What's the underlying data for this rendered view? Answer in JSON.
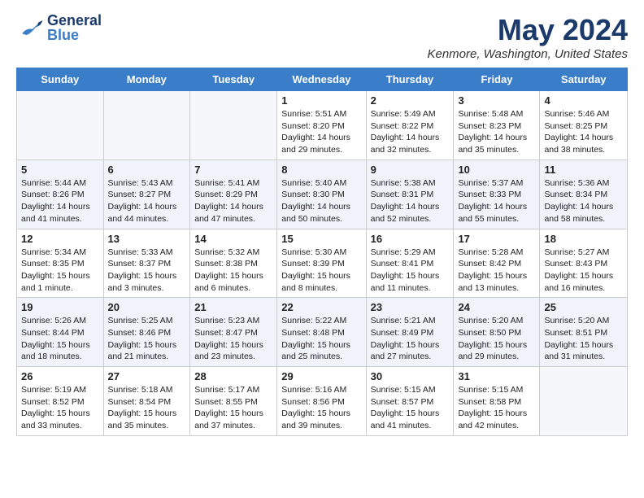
{
  "header": {
    "logo_general": "General",
    "logo_blue": "Blue",
    "month_title": "May 2024",
    "location": "Kenmore, Washington, United States"
  },
  "days_of_week": [
    "Sunday",
    "Monday",
    "Tuesday",
    "Wednesday",
    "Thursday",
    "Friday",
    "Saturday"
  ],
  "weeks": [
    [
      {
        "day": "",
        "sunrise": "",
        "sunset": "",
        "daylight": ""
      },
      {
        "day": "",
        "sunrise": "",
        "sunset": "",
        "daylight": ""
      },
      {
        "day": "",
        "sunrise": "",
        "sunset": "",
        "daylight": ""
      },
      {
        "day": "1",
        "sunrise": "Sunrise: 5:51 AM",
        "sunset": "Sunset: 8:20 PM",
        "daylight": "Daylight: 14 hours and 29 minutes."
      },
      {
        "day": "2",
        "sunrise": "Sunrise: 5:49 AM",
        "sunset": "Sunset: 8:22 PM",
        "daylight": "Daylight: 14 hours and 32 minutes."
      },
      {
        "day": "3",
        "sunrise": "Sunrise: 5:48 AM",
        "sunset": "Sunset: 8:23 PM",
        "daylight": "Daylight: 14 hours and 35 minutes."
      },
      {
        "day": "4",
        "sunrise": "Sunrise: 5:46 AM",
        "sunset": "Sunset: 8:25 PM",
        "daylight": "Daylight: 14 hours and 38 minutes."
      }
    ],
    [
      {
        "day": "5",
        "sunrise": "Sunrise: 5:44 AM",
        "sunset": "Sunset: 8:26 PM",
        "daylight": "Daylight: 14 hours and 41 minutes."
      },
      {
        "day": "6",
        "sunrise": "Sunrise: 5:43 AM",
        "sunset": "Sunset: 8:27 PM",
        "daylight": "Daylight: 14 hours and 44 minutes."
      },
      {
        "day": "7",
        "sunrise": "Sunrise: 5:41 AM",
        "sunset": "Sunset: 8:29 PM",
        "daylight": "Daylight: 14 hours and 47 minutes."
      },
      {
        "day": "8",
        "sunrise": "Sunrise: 5:40 AM",
        "sunset": "Sunset: 8:30 PM",
        "daylight": "Daylight: 14 hours and 50 minutes."
      },
      {
        "day": "9",
        "sunrise": "Sunrise: 5:38 AM",
        "sunset": "Sunset: 8:31 PM",
        "daylight": "Daylight: 14 hours and 52 minutes."
      },
      {
        "day": "10",
        "sunrise": "Sunrise: 5:37 AM",
        "sunset": "Sunset: 8:33 PM",
        "daylight": "Daylight: 14 hours and 55 minutes."
      },
      {
        "day": "11",
        "sunrise": "Sunrise: 5:36 AM",
        "sunset": "Sunset: 8:34 PM",
        "daylight": "Daylight: 14 hours and 58 minutes."
      }
    ],
    [
      {
        "day": "12",
        "sunrise": "Sunrise: 5:34 AM",
        "sunset": "Sunset: 8:35 PM",
        "daylight": "Daylight: 15 hours and 1 minute."
      },
      {
        "day": "13",
        "sunrise": "Sunrise: 5:33 AM",
        "sunset": "Sunset: 8:37 PM",
        "daylight": "Daylight: 15 hours and 3 minutes."
      },
      {
        "day": "14",
        "sunrise": "Sunrise: 5:32 AM",
        "sunset": "Sunset: 8:38 PM",
        "daylight": "Daylight: 15 hours and 6 minutes."
      },
      {
        "day": "15",
        "sunrise": "Sunrise: 5:30 AM",
        "sunset": "Sunset: 8:39 PM",
        "daylight": "Daylight: 15 hours and 8 minutes."
      },
      {
        "day": "16",
        "sunrise": "Sunrise: 5:29 AM",
        "sunset": "Sunset: 8:41 PM",
        "daylight": "Daylight: 15 hours and 11 minutes."
      },
      {
        "day": "17",
        "sunrise": "Sunrise: 5:28 AM",
        "sunset": "Sunset: 8:42 PM",
        "daylight": "Daylight: 15 hours and 13 minutes."
      },
      {
        "day": "18",
        "sunrise": "Sunrise: 5:27 AM",
        "sunset": "Sunset: 8:43 PM",
        "daylight": "Daylight: 15 hours and 16 minutes."
      }
    ],
    [
      {
        "day": "19",
        "sunrise": "Sunrise: 5:26 AM",
        "sunset": "Sunset: 8:44 PM",
        "daylight": "Daylight: 15 hours and 18 minutes."
      },
      {
        "day": "20",
        "sunrise": "Sunrise: 5:25 AM",
        "sunset": "Sunset: 8:46 PM",
        "daylight": "Daylight: 15 hours and 21 minutes."
      },
      {
        "day": "21",
        "sunrise": "Sunrise: 5:23 AM",
        "sunset": "Sunset: 8:47 PM",
        "daylight": "Daylight: 15 hours and 23 minutes."
      },
      {
        "day": "22",
        "sunrise": "Sunrise: 5:22 AM",
        "sunset": "Sunset: 8:48 PM",
        "daylight": "Daylight: 15 hours and 25 minutes."
      },
      {
        "day": "23",
        "sunrise": "Sunrise: 5:21 AM",
        "sunset": "Sunset: 8:49 PM",
        "daylight": "Daylight: 15 hours and 27 minutes."
      },
      {
        "day": "24",
        "sunrise": "Sunrise: 5:20 AM",
        "sunset": "Sunset: 8:50 PM",
        "daylight": "Daylight: 15 hours and 29 minutes."
      },
      {
        "day": "25",
        "sunrise": "Sunrise: 5:20 AM",
        "sunset": "Sunset: 8:51 PM",
        "daylight": "Daylight: 15 hours and 31 minutes."
      }
    ],
    [
      {
        "day": "26",
        "sunrise": "Sunrise: 5:19 AM",
        "sunset": "Sunset: 8:52 PM",
        "daylight": "Daylight: 15 hours and 33 minutes."
      },
      {
        "day": "27",
        "sunrise": "Sunrise: 5:18 AM",
        "sunset": "Sunset: 8:54 PM",
        "daylight": "Daylight: 15 hours and 35 minutes."
      },
      {
        "day": "28",
        "sunrise": "Sunrise: 5:17 AM",
        "sunset": "Sunset: 8:55 PM",
        "daylight": "Daylight: 15 hours and 37 minutes."
      },
      {
        "day": "29",
        "sunrise": "Sunrise: 5:16 AM",
        "sunset": "Sunset: 8:56 PM",
        "daylight": "Daylight: 15 hours and 39 minutes."
      },
      {
        "day": "30",
        "sunrise": "Sunrise: 5:15 AM",
        "sunset": "Sunset: 8:57 PM",
        "daylight": "Daylight: 15 hours and 41 minutes."
      },
      {
        "day": "31",
        "sunrise": "Sunrise: 5:15 AM",
        "sunset": "Sunset: 8:58 PM",
        "daylight": "Daylight: 15 hours and 42 minutes."
      },
      {
        "day": "",
        "sunrise": "",
        "sunset": "",
        "daylight": ""
      }
    ]
  ]
}
